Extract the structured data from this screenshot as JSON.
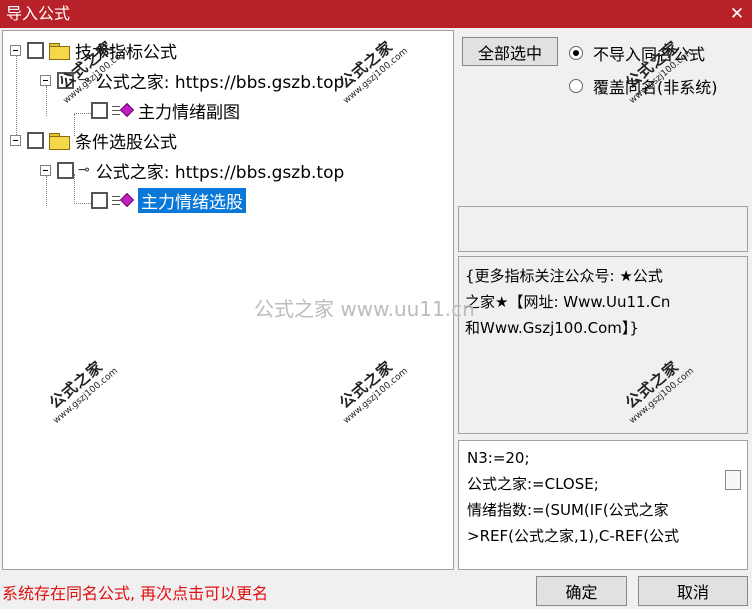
{
  "window": {
    "title": "导入公式",
    "close_glyph": "✕"
  },
  "tree": {
    "items": [
      {
        "label": "技术指标公式"
      },
      {
        "label": "公式之家: https://bbs.gszb.top"
      },
      {
        "label": "主力情绪副图"
      },
      {
        "label": "条件选股公式"
      },
      {
        "label": "公式之家: https://bbs.gszb.top"
      },
      {
        "label": "主力情绪选股"
      }
    ]
  },
  "options": {
    "select_all": "全部选中",
    "radio_no_import": "不导入同名公式",
    "radio_overwrite": "覆盖同名(非系统)"
  },
  "description": {
    "line1": "{更多指标关注公众号: ★公式",
    "line2": "之家★【网址: Www.Uu11.Cn",
    "line3": "和Www.Gszj100.Com】}"
  },
  "code": {
    "line1": "N3:=20;",
    "line2": "公式之家:=CLOSE;",
    "line3": "情绪指数:=(SUM(IF(公式之家",
    "line4": ">REF(公式之家,1),C-REF(公式"
  },
  "status": "系统存在同名公式, 再次点击可以更名",
  "buttons": {
    "ok": "确定",
    "cancel": "取消"
  },
  "watermark": {
    "center": "公式之家 www.uu11.cn",
    "cn": "公式之家",
    "url": "www.gszj100.com"
  },
  "colors": {
    "titlebar": "#b82127",
    "selection": "#0a78d7",
    "status": "#e01010"
  }
}
